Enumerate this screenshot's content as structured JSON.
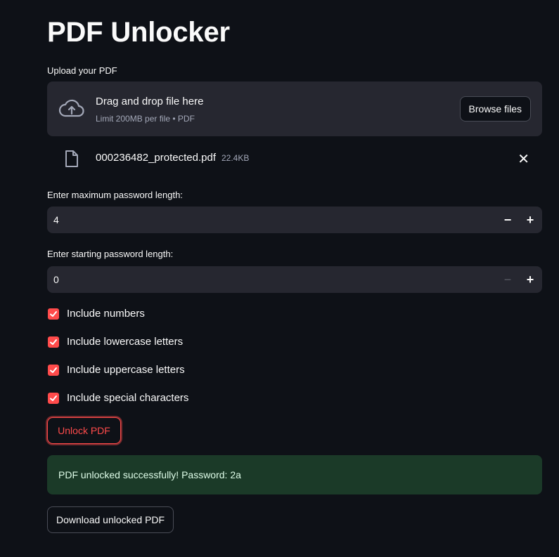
{
  "page": {
    "title": "PDF Unlocker"
  },
  "uploader": {
    "label": "Upload your PDF",
    "drop_title": "Drag and drop file here",
    "drop_subtitle": "Limit 200MB per file • PDF",
    "browse_label": "Browse files",
    "upload_icon": "cloud-upload-icon"
  },
  "file": {
    "name": "000236482_protected.pdf",
    "size": "22.4KB",
    "icon": "file-icon",
    "remove_icon": "close-icon",
    "remove_glyph": "✕"
  },
  "max_length": {
    "label": "Enter maximum password length:",
    "value": "4",
    "minus": "−",
    "plus": "+"
  },
  "start_length": {
    "label": "Enter starting password length:",
    "value": "0",
    "minus": "−",
    "plus": "+"
  },
  "options": [
    {
      "label": "Include numbers",
      "checked": true
    },
    {
      "label": "Include lowercase letters",
      "checked": true
    },
    {
      "label": "Include uppercase letters",
      "checked": true
    },
    {
      "label": "Include special characters",
      "checked": true
    }
  ],
  "unlock_button": {
    "label": "Unlock PDF"
  },
  "success_message": "PDF unlocked successfully! Password: 2a",
  "download_button": {
    "label": "Download unlocked PDF"
  },
  "colors": {
    "background": "#0e1117",
    "surface": "#262730",
    "accent": "#ff4b4b",
    "success_bg": "#1b3a28"
  }
}
